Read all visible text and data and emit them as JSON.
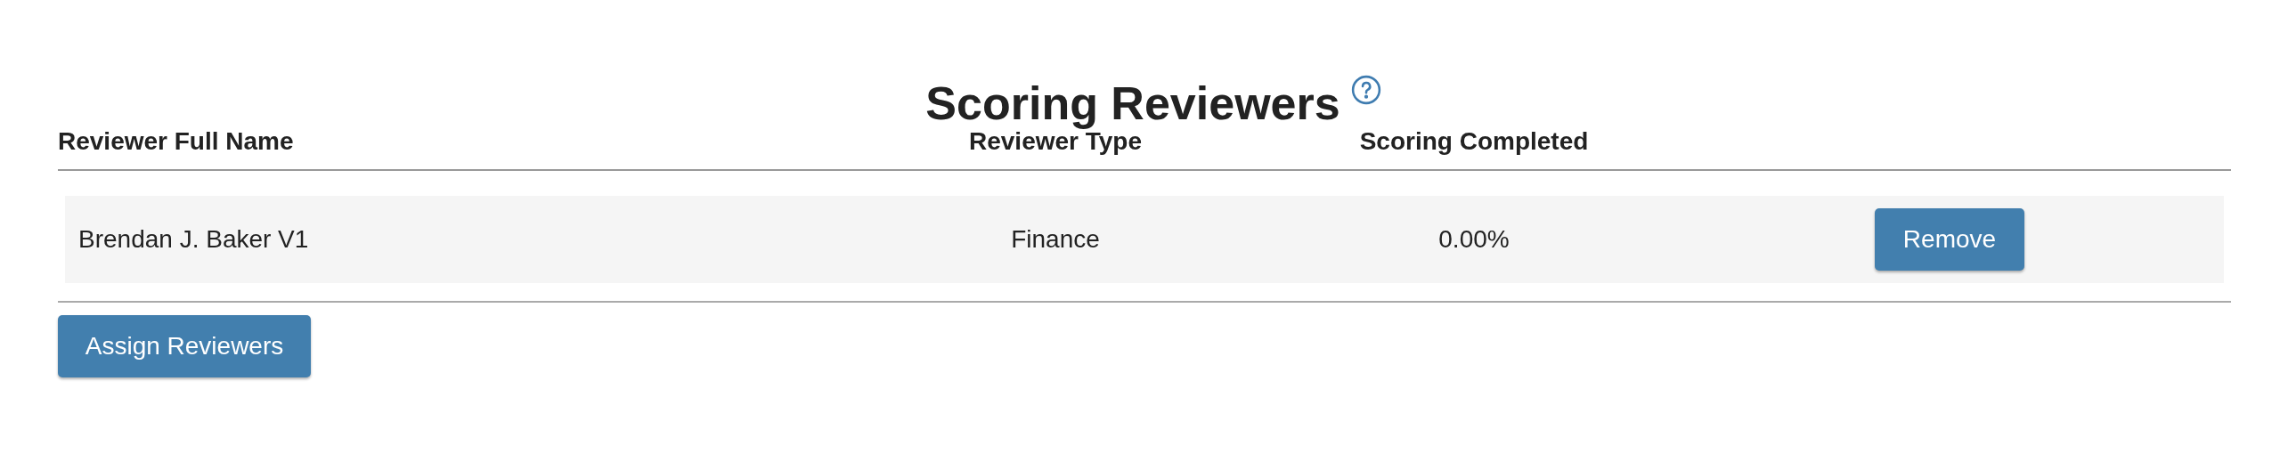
{
  "title": "Scoring Reviewers",
  "table": {
    "columns": [
      "Reviewer Full Name",
      "Reviewer Type",
      "Scoring Completed"
    ],
    "rows": [
      {
        "name": "Brendan J. Baker V1",
        "type": "Finance",
        "scoring_completed": "0.00%",
        "action": "Remove"
      }
    ]
  },
  "assign_button": "Assign Reviewers"
}
